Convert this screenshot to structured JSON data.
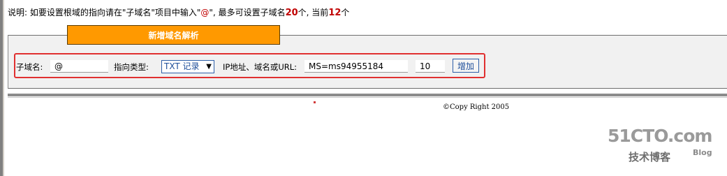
{
  "notice": {
    "prefix": "说明: 如要设置根域的指向请在\"子域名\"项目中输入\"",
    "at_symbol": "@",
    "middle": "\", 最多可设置子域名",
    "max_count": "20",
    "after_max": "个, 当前",
    "current_count": "12",
    "suffix": "个"
  },
  "tab": {
    "title": "新增域名解析"
  },
  "form": {
    "subdomain_label": "子域名:",
    "subdomain_value": "@",
    "type_label": "指向类型:",
    "type_selected": "TXT 记录",
    "target_label": "IP地址、域名或URL:",
    "target_value": "MS=ms94955184",
    "ttl_value": "10",
    "add_button": "增加"
  },
  "footer": {
    "copyright": "©Copy Right 2005"
  },
  "watermark": {
    "site": "51CTO.com",
    "tagline": "技术博客",
    "blog": "Blog"
  },
  "colors": {
    "tab_orange": "#ff9900",
    "highlight_red": "#e03030",
    "count_red": "#c00000",
    "button_blue": "#2d5fa8"
  }
}
